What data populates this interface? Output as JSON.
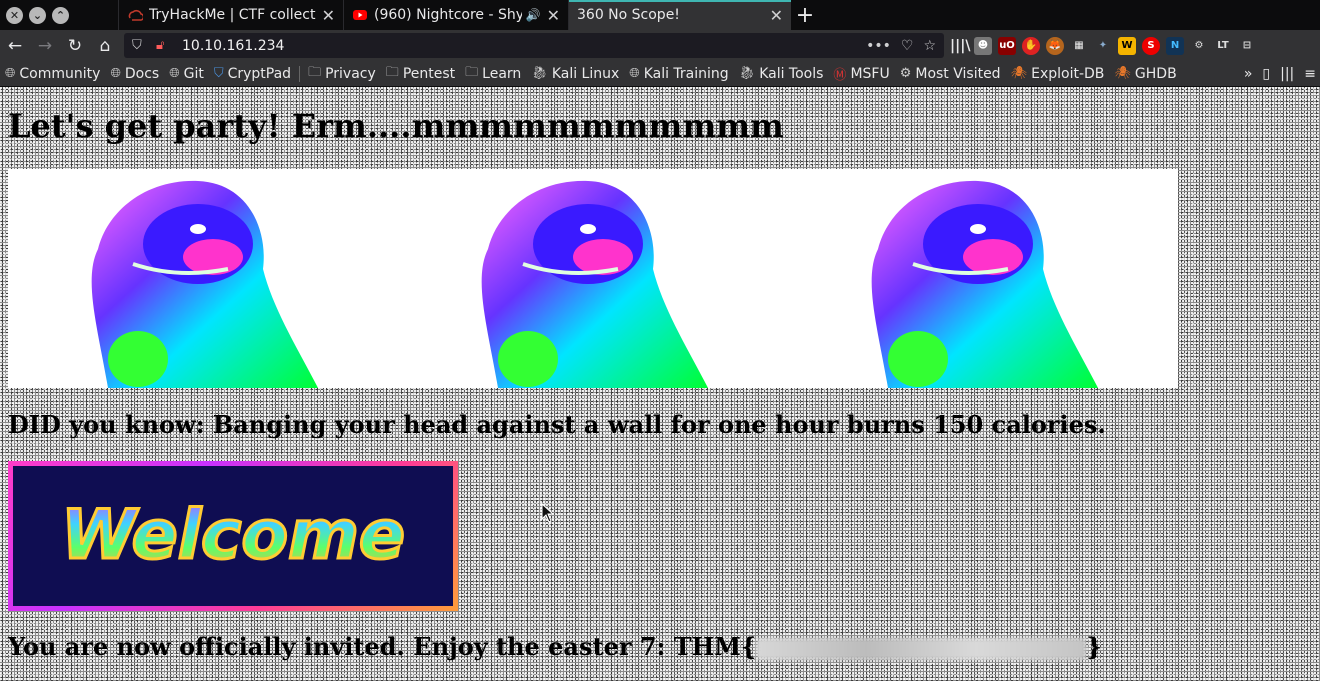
{
  "window_controls": [
    "✕",
    "⌄",
    "⌃"
  ],
  "tabs": [
    {
      "title": "TryHackMe | CTF collecti",
      "icon": "tryhackme-icon"
    },
    {
      "title": "(960) Nightcore - Shy",
      "icon": "youtube-icon",
      "audio": "🔊"
    },
    {
      "title": "360 No Scope!",
      "icon": "none",
      "active": true
    }
  ],
  "new_tab": "+",
  "nav": {
    "url": "10.10.161.234",
    "back": "←",
    "forward": "→",
    "reload": "↻",
    "home": "⌂",
    "more": "•••"
  },
  "bookmarks": [
    {
      "label": "Community",
      "icon": "globe-icon"
    },
    {
      "label": "Docs",
      "icon": "globe-icon"
    },
    {
      "label": "Git",
      "icon": "globe-icon"
    },
    {
      "label": "CryptPad",
      "icon": "shield-icon"
    },
    {
      "label": "Privacy",
      "icon": "folder-icon"
    },
    {
      "label": "Pentest",
      "icon": "folder-icon"
    },
    {
      "label": "Learn",
      "icon": "folder-icon"
    },
    {
      "label": "Kali Linux",
      "icon": "kali-icon"
    },
    {
      "label": "Kali Training",
      "icon": "globe-icon"
    },
    {
      "label": "Kali Tools",
      "icon": "kali-icon"
    },
    {
      "label": "MSFU",
      "icon": "msfu-icon"
    },
    {
      "label": "Most Visited",
      "icon": "gear-icon"
    },
    {
      "label": "Exploit-DB",
      "icon": "exploitdb-icon"
    },
    {
      "label": "GHDB",
      "icon": "exploitdb-icon"
    }
  ],
  "page": {
    "heading": "Let's get party! Erm....mmmmmmmmmmm",
    "fact": "DID you know: Banging your head against a wall for one hour burns 150 calories.",
    "welcome_text": "Welcome",
    "flag_prefix": "You are now officially invited. Enjoy the easter 7: THM{",
    "flag_suffix": "}"
  },
  "colors": {
    "tab_accent": "#3fb6b2",
    "chrome_bg": "#323234",
    "welcome_bg": "#0f0d52"
  }
}
